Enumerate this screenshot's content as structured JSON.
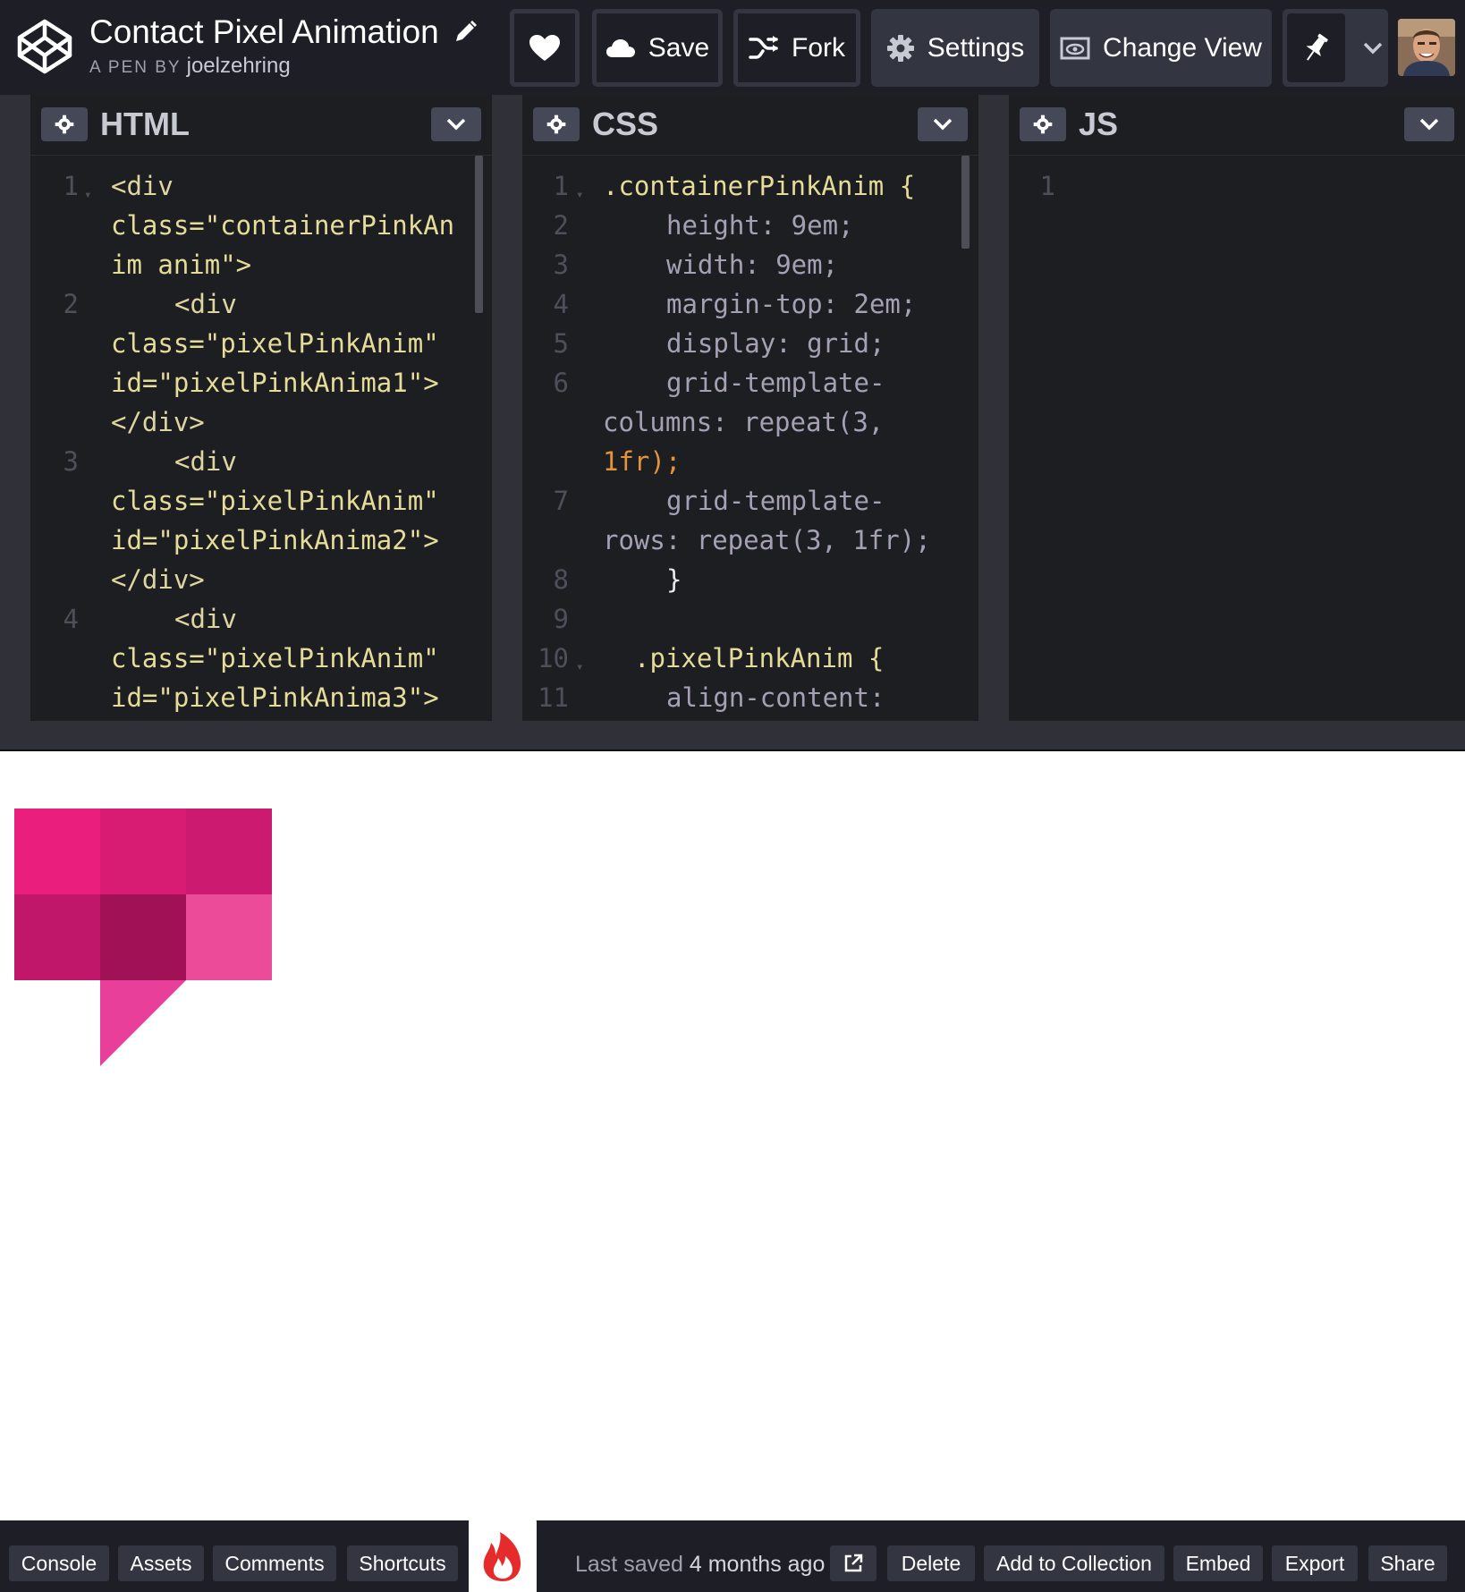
{
  "header": {
    "pen_title": "Contact Pixel Animation",
    "by_label": "A PEN BY",
    "author": "joelzehring",
    "like_icon": "heart-icon",
    "save_label": "Save",
    "fork_label": "Fork",
    "settings_label": "Settings",
    "change_view_label": "Change View",
    "pin_icon": "pin-icon"
  },
  "editors": {
    "html": {
      "title": "HTML",
      "line_numbers": [
        "1",
        "2",
        "3",
        "4"
      ],
      "lines": [
        "<div",
        "class=\"containerPinkAn",
        "im anim\">",
        "<div",
        "class=\"pixelPinkAnim\"",
        "id=\"pixelPinkAnima1\">",
        "</div>",
        "<div",
        "class=\"pixelPinkAnim\"",
        "id=\"pixelPinkAnima2\">",
        "</div>",
        "<div",
        "class=\"pixelPinkAnim\"",
        "id=\"pixelPinkAnima3\">"
      ]
    },
    "css": {
      "title": "CSS",
      "line_numbers": [
        "1",
        "2",
        "3",
        "4",
        "5",
        "6",
        "7",
        "8",
        "9",
        "10",
        "11"
      ],
      "lines": [
        ".containerPinkAnim {",
        "height: 9em;",
        "width: 9em;",
        "margin-top: 2em;",
        "display: grid;",
        "grid-template-",
        "columns: repeat(3,",
        "1fr);",
        "grid-template-",
        "rows: repeat(3, 1fr);",
        "}",
        ".pixelPinkAnim {",
        "align-content:"
      ]
    },
    "js": {
      "title": "JS",
      "line_numbers": [
        "1"
      ]
    }
  },
  "preview": {
    "pixel_colors": [
      "#e91e7d",
      "#d81b73",
      "#cb1a6f",
      "#c0176a",
      "#a01155",
      "#ec4b9a",
      "#e8409a"
    ]
  },
  "footer": {
    "console_label": "Console",
    "assets_label": "Assets",
    "comments_label": "Comments",
    "shortcuts_label": "Shortcuts",
    "flame_icon": "flame-icon",
    "last_saved_prefix": "Last saved",
    "last_saved_time": "4 months ago",
    "external_icon": "external-link-icon",
    "delete_label": "Delete",
    "add_to_collection_label": "Add to Collection",
    "embed_label": "Embed",
    "export_label": "Export",
    "share_label": "Share"
  }
}
